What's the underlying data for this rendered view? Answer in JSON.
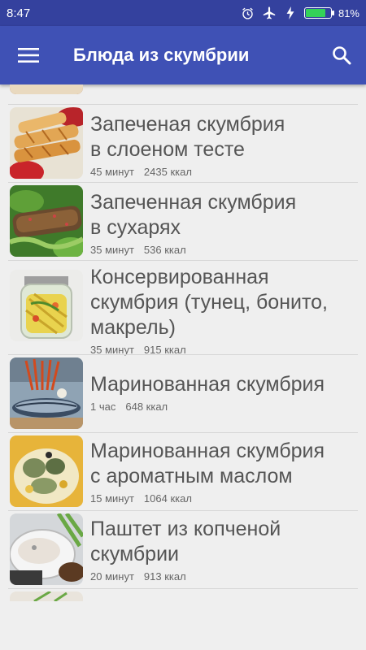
{
  "status_bar": {
    "time": "8:47",
    "battery_percent": "81%",
    "battery_level": 0.81,
    "icons": [
      "alarm-icon",
      "airplane-icon",
      "charging-icon",
      "battery-icon"
    ]
  },
  "app_bar": {
    "title": "Блюда из скумбрии",
    "menu_icon": "menu-icon",
    "search_icon": "search-icon"
  },
  "recipes": [
    {
      "title_lines": [
        "Запеченая скумбрия",
        "в слоеном тесте"
      ],
      "time": "45 минут",
      "kcal": "2435 ккал"
    },
    {
      "title_lines": [
        "Запеченная скумбрия",
        "в сухарях"
      ],
      "time": "35 минут",
      "kcal": "536 ккал"
    },
    {
      "title_lines": [
        "Консервированная",
        "скумбрия (тунец, бонито,",
        "макрель)"
      ],
      "time": "35 минут",
      "kcal": "915 ккал"
    },
    {
      "title_lines": [
        "Маринованная скумбрия"
      ],
      "time": "1 час",
      "kcal": "648 ккал"
    },
    {
      "title_lines": [
        "Маринованная скумбрия",
        "с ароматным маслом"
      ],
      "time": "15 минут",
      "kcal": "1064 ккал"
    },
    {
      "title_lines": [
        "Паштет из копченой",
        "скумбрии"
      ],
      "time": "20 минут",
      "kcal": "913 ккал"
    }
  ],
  "colors": {
    "status_bar": "#34419e",
    "app_bar": "#3f51b5",
    "background": "#efefef",
    "title_text": "#555555",
    "meta_text": "#666666",
    "battery_fill": "#34d158"
  }
}
